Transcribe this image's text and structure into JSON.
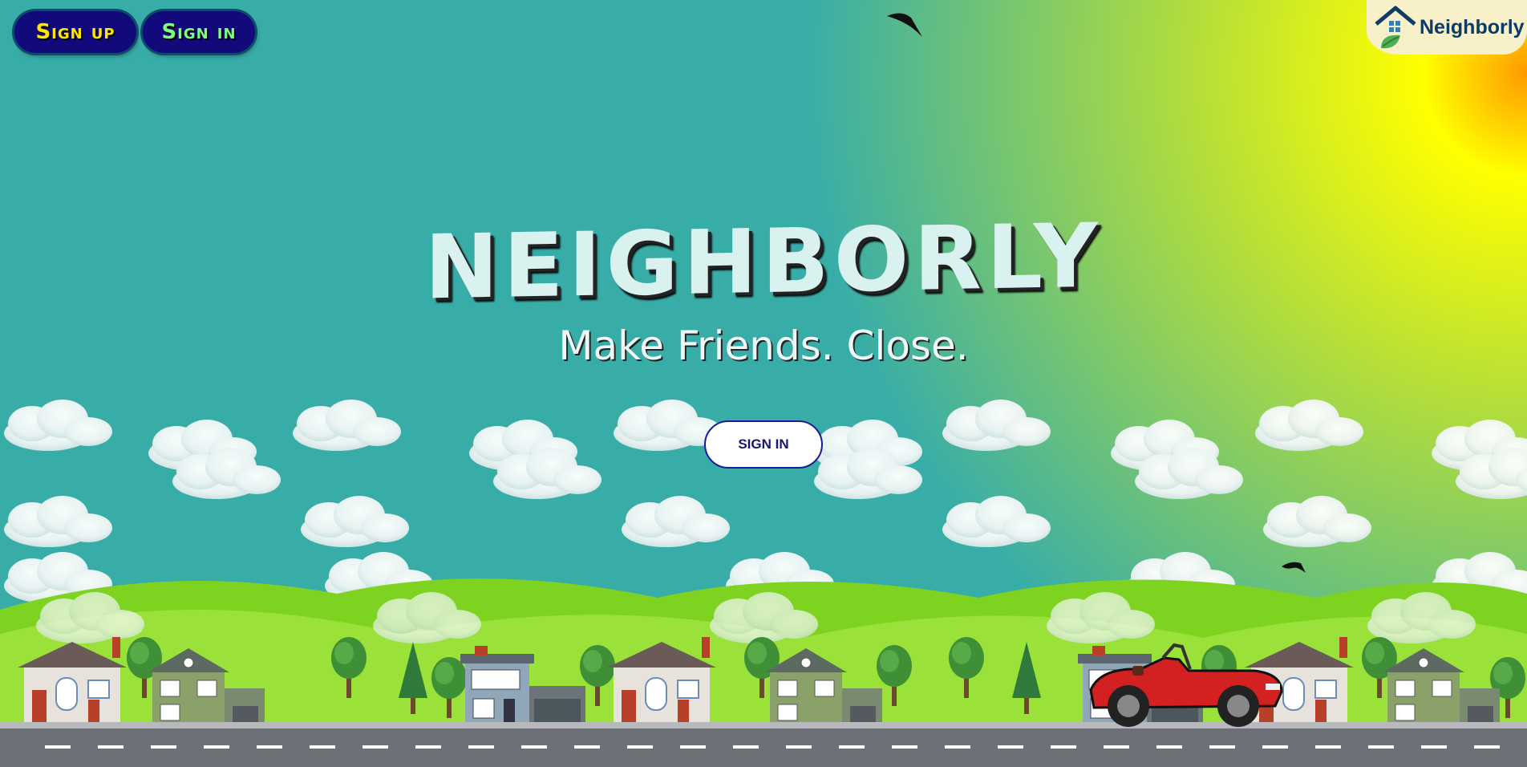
{
  "header": {
    "signup_label": "Sign up",
    "signin_label": "Sign in"
  },
  "logo": {
    "text": "Neighborly",
    "icon": "house-leaf-icon"
  },
  "hero": {
    "title": "NEIGHBORLY",
    "tagline": "Make Friends. Close.",
    "signin_button_label": "SIGN IN"
  },
  "colors": {
    "sky": "#38ada8",
    "sun": "#ffff00",
    "button_bg": "#120a7a",
    "signup_text": "#ffe600",
    "signin_text": "#7dff7a",
    "title_text": "#d9f1ef",
    "road": "#6e7077",
    "grass": "#7ed321",
    "car": "#d32020"
  }
}
